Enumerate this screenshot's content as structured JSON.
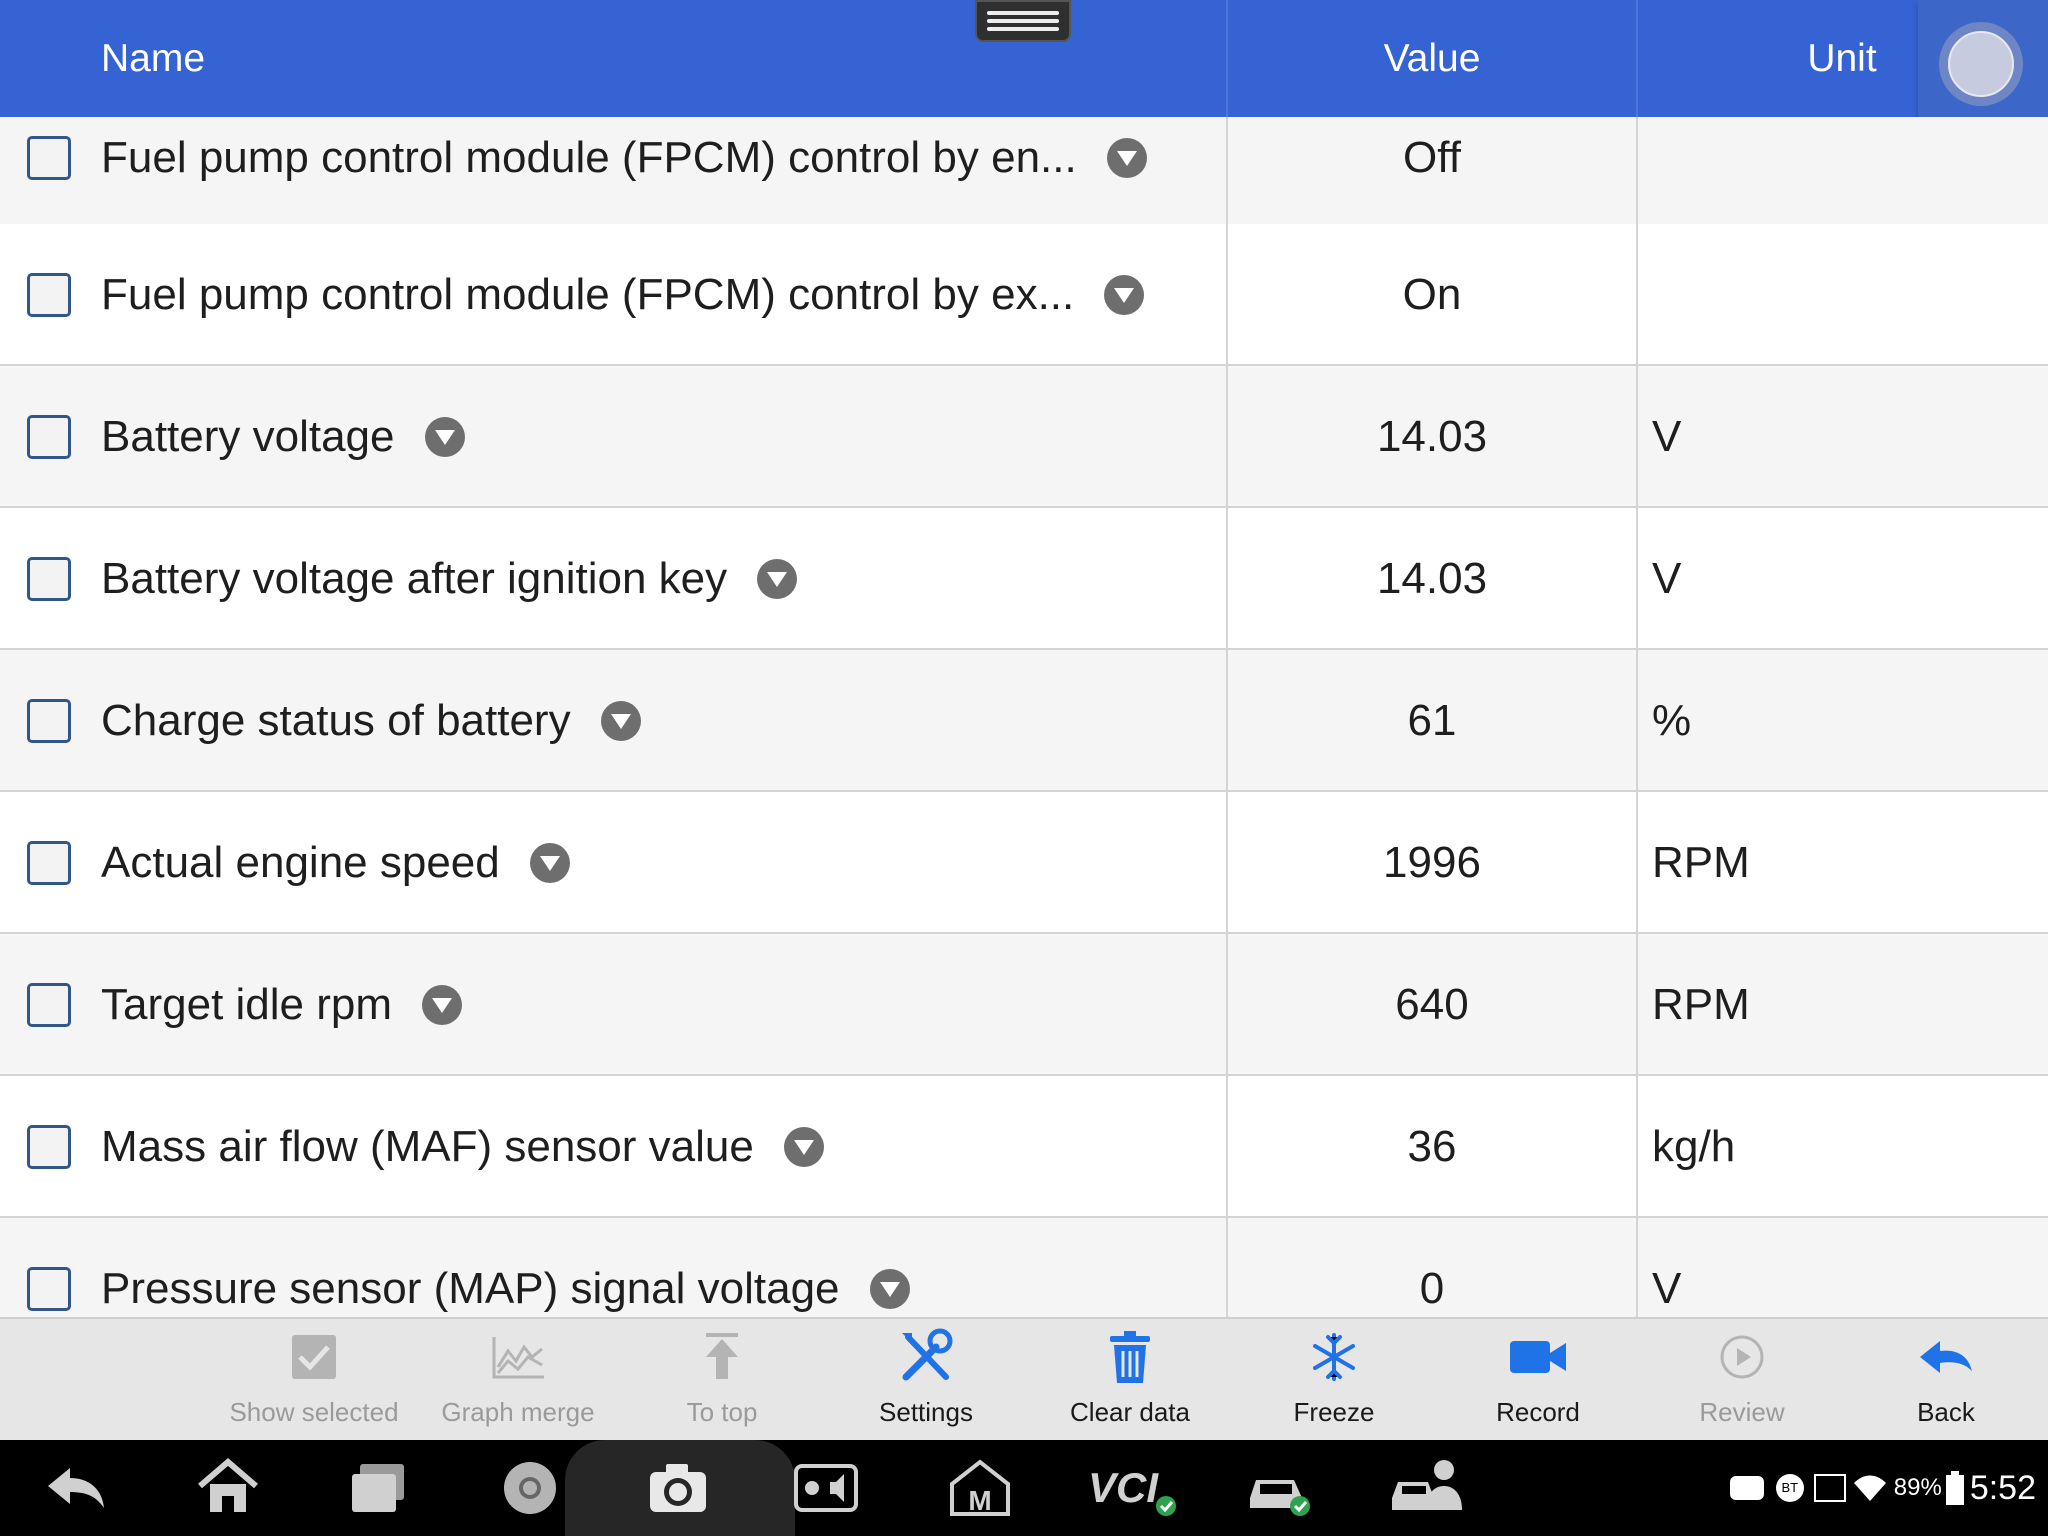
{
  "header": {
    "name_label": "Name",
    "value_label": "Value",
    "unit_label": "Unit",
    "color": "#3563d4"
  },
  "rows": [
    {
      "name": "Fuel pump control module (FPCM) control by en...",
      "value": "Off",
      "unit": ""
    },
    {
      "name": "Fuel pump control module (FPCM) control by ex...",
      "value": "On",
      "unit": ""
    },
    {
      "name": "Battery voltage",
      "value": "14.03",
      "unit": "V"
    },
    {
      "name": "Battery voltage after ignition key",
      "value": "14.03",
      "unit": "V"
    },
    {
      "name": "Charge status of battery",
      "value": "61",
      "unit": "%"
    },
    {
      "name": "Actual engine speed",
      "value": "1996",
      "unit": "RPM"
    },
    {
      "name": "Target idle rpm",
      "value": "640",
      "unit": "RPM"
    },
    {
      "name": "Mass air flow (MAF) sensor value",
      "value": "36",
      "unit": "kg/h"
    },
    {
      "name": "Pressure sensor (MAP) signal voltage",
      "value": "0",
      "unit": "V"
    }
  ],
  "toolbar": {
    "show_selected": "Show selected",
    "graph_merge": "Graph merge",
    "to_top": "To top",
    "settings": "Settings",
    "clear_data": "Clear data",
    "freeze": "Freeze",
    "record": "Record",
    "review": "Review",
    "back": "Back",
    "accent": "#1f73e6"
  },
  "system_bar": {
    "nav_icons": [
      "back-icon",
      "home-icon",
      "recent-apps-icon",
      "browser-icon",
      "camera-icon",
      "display-settings-icon",
      "maxifix-icon",
      "vci-icon",
      "vehicle-connected-icon",
      "remote-support-icon"
    ],
    "battery": "89%",
    "time": "5:52"
  }
}
